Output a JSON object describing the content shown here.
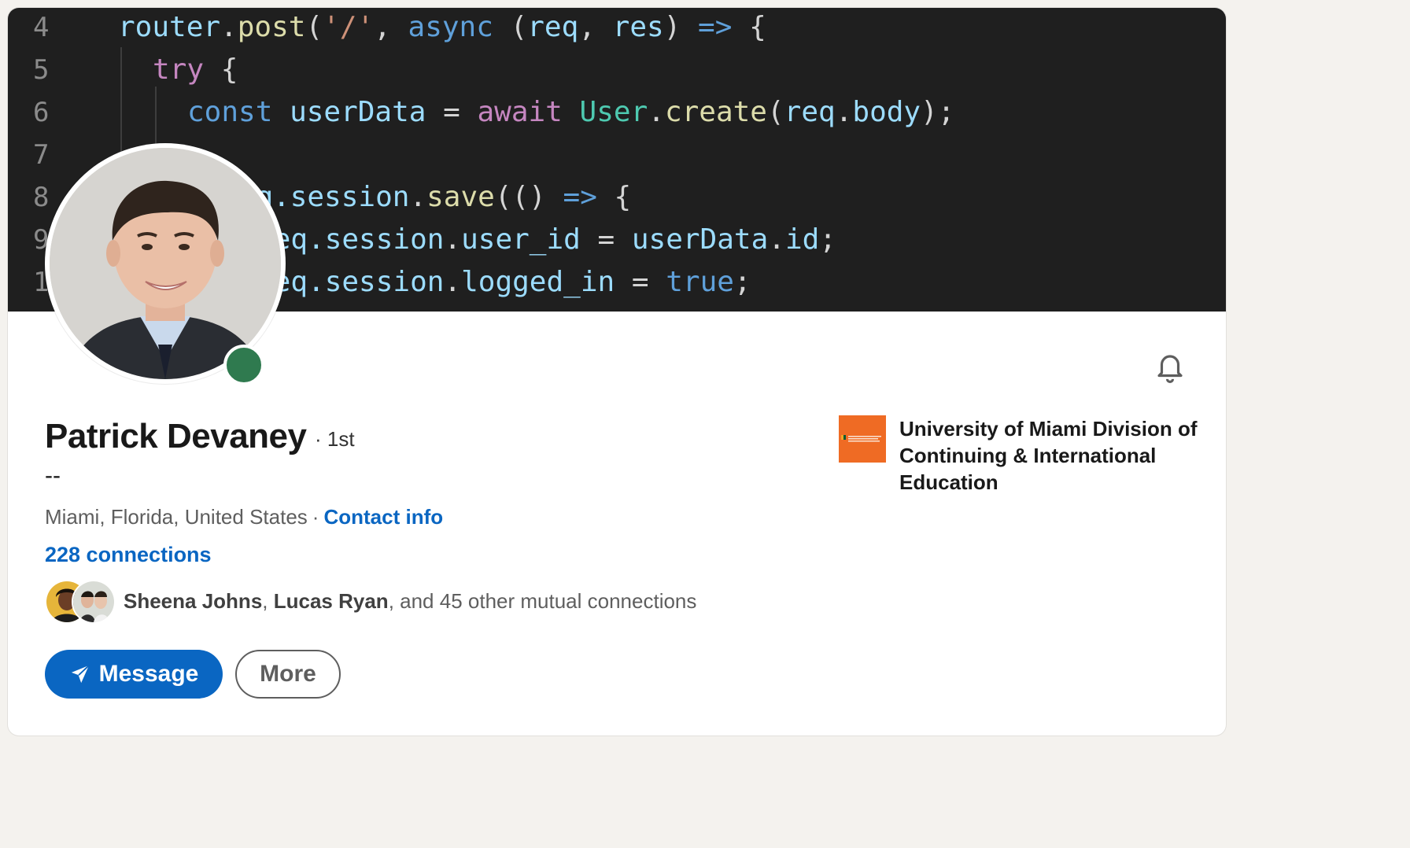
{
  "banner": {
    "code_lines": [
      {
        "num": "4",
        "parts": [
          {
            "t": "router",
            "c": "kw-light"
          },
          {
            "t": ".",
            "c": "kw-plain"
          },
          {
            "t": "post",
            "c": "kw-yellow"
          },
          {
            "t": "(",
            "c": "kw-plain"
          },
          {
            "t": "'/'",
            "c": "kw-str"
          },
          {
            "t": ", ",
            "c": "kw-plain"
          },
          {
            "t": "async",
            "c": "kw-blue"
          },
          {
            "t": " (",
            "c": "kw-plain"
          },
          {
            "t": "req",
            "c": "kw-light"
          },
          {
            "t": ", ",
            "c": "kw-plain"
          },
          {
            "t": "res",
            "c": "kw-light"
          },
          {
            "t": ") ",
            "c": "kw-plain"
          },
          {
            "t": "=>",
            "c": "kw-blue"
          },
          {
            "t": " {",
            "c": "kw-plain"
          }
        ]
      },
      {
        "num": "5",
        "parts": [
          {
            "t": "try",
            "c": "kw-purple"
          },
          {
            "t": " {",
            "c": "kw-plain"
          }
        ]
      },
      {
        "num": "6",
        "parts": [
          {
            "t": "const",
            "c": "kw-blue"
          },
          {
            "t": " ",
            "c": "kw-plain"
          },
          {
            "t": "userData",
            "c": "kw-light"
          },
          {
            "t": " = ",
            "c": "kw-plain"
          },
          {
            "t": "await",
            "c": "kw-purple"
          },
          {
            "t": " ",
            "c": "kw-plain"
          },
          {
            "t": "User",
            "c": "kw-teal"
          },
          {
            "t": ".",
            "c": "kw-plain"
          },
          {
            "t": "create",
            "c": "kw-yellow"
          },
          {
            "t": "(",
            "c": "kw-plain"
          },
          {
            "t": "req",
            "c": "kw-light"
          },
          {
            "t": ".",
            "c": "kw-plain"
          },
          {
            "t": "body",
            "c": "kw-light"
          },
          {
            "t": ");",
            "c": "kw-plain"
          }
        ]
      },
      {
        "num": "7",
        "parts": []
      },
      {
        "num": "8",
        "parts": [
          {
            "t": "req.",
            "c": "kw-light"
          },
          {
            "t": "session",
            "c": "kw-light"
          },
          {
            "t": ".",
            "c": "kw-plain"
          },
          {
            "t": "save",
            "c": "kw-yellow"
          },
          {
            "t": "(() ",
            "c": "kw-plain"
          },
          {
            "t": "=>",
            "c": "kw-blue"
          },
          {
            "t": " {",
            "c": "kw-plain"
          }
        ]
      },
      {
        "num": "9",
        "parts": [
          {
            "t": "req.",
            "c": "kw-light"
          },
          {
            "t": "session",
            "c": "kw-light"
          },
          {
            "t": ".",
            "c": "kw-plain"
          },
          {
            "t": "user_id",
            "c": "kw-light"
          },
          {
            "t": " = ",
            "c": "kw-plain"
          },
          {
            "t": "userData",
            "c": "kw-light"
          },
          {
            "t": ".",
            "c": "kw-plain"
          },
          {
            "t": "id",
            "c": "kw-light"
          },
          {
            "t": ";",
            "c": "kw-plain"
          }
        ]
      },
      {
        "num": "10",
        "parts": [
          {
            "t": "req.",
            "c": "kw-light"
          },
          {
            "t": "session",
            "c": "kw-light"
          },
          {
            "t": ".",
            "c": "kw-plain"
          },
          {
            "t": "logged_in",
            "c": "kw-light"
          },
          {
            "t": " = ",
            "c": "kw-plain"
          },
          {
            "t": "true",
            "c": "kw-blue"
          },
          {
            "t": ";",
            "c": "kw-plain"
          }
        ]
      }
    ]
  },
  "profile": {
    "name": "Patrick Devaney",
    "degree": "· 1st",
    "headline": "--",
    "location": "Miami, Florida, United States",
    "separator": "·",
    "contact_info": "Contact info",
    "connections": "228 connections",
    "mutual": {
      "name1": "Sheena Johns",
      "comma": ", ",
      "name2": "Lucas Ryan",
      "rest": ", and 45 other mutual connections"
    },
    "online_status": "online"
  },
  "actions": {
    "message_label": "Message",
    "more_label": "More"
  },
  "education": {
    "name": "University of Miami Division of Continuing & International Education"
  },
  "icons": {
    "bell": "bell-icon",
    "send": "send-icon"
  },
  "colors": {
    "accent": "#0a66c2",
    "online": "#2f7a4f",
    "edu_logo": "#ef6b24",
    "banner_bg": "#1f1f1f"
  }
}
